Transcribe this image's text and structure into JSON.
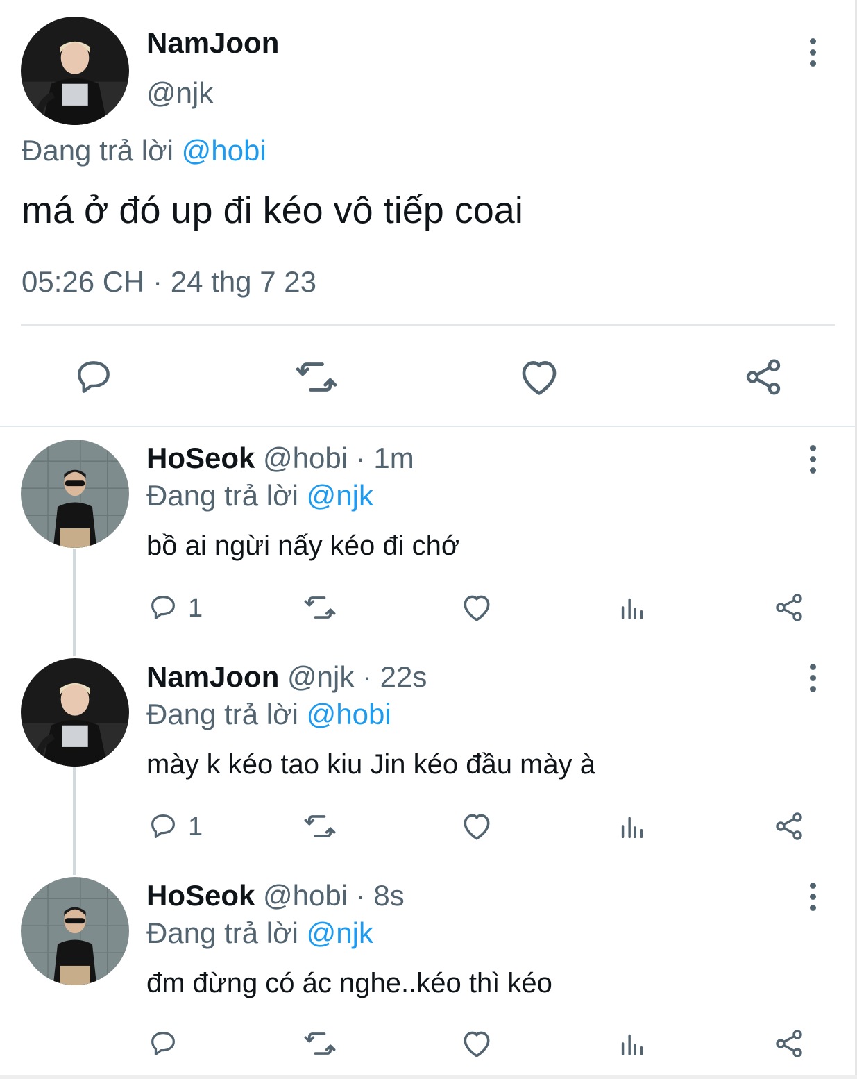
{
  "main_tweet": {
    "name": "NamJoon",
    "handle": "@njk",
    "replying_prefix": "Đang trả lời",
    "replying_to": "@hobi",
    "text": "má ở đó up đi kéo vô tiếp coai",
    "timestamp": "05:26 CH · 24 thg 7 23",
    "actions": [
      "reply-icon",
      "retweet-icon",
      "like-icon",
      "share-icon"
    ]
  },
  "replies": [
    {
      "name": "HoSeok",
      "handle": "@hobi",
      "time": "· 1m",
      "replying_prefix": "Đang trả lời",
      "replying_to": "@njk",
      "text": "bồ ai ngừi nấy kéo đi chớ",
      "reply_count": "1"
    },
    {
      "name": "NamJoon",
      "handle": "@njk",
      "time": "· 22s",
      "replying_prefix": "Đang trả lời",
      "replying_to": "@hobi",
      "text": "mày k kéo tao kiu Jin  kéo đầu mày à",
      "reply_count": "1"
    },
    {
      "name": "HoSeok",
      "handle": "@hobi",
      "time": "· 8s",
      "replying_prefix": "Đang trả lời",
      "replying_to": "@njk",
      "text": "đm đừng có ác nghe..kéo thì kéo",
      "reply_count": ""
    }
  ],
  "colors": {
    "text": "#0f1419",
    "secondary": "#536471",
    "accent": "#1d9bf0",
    "divider": "#e1e8ed"
  }
}
